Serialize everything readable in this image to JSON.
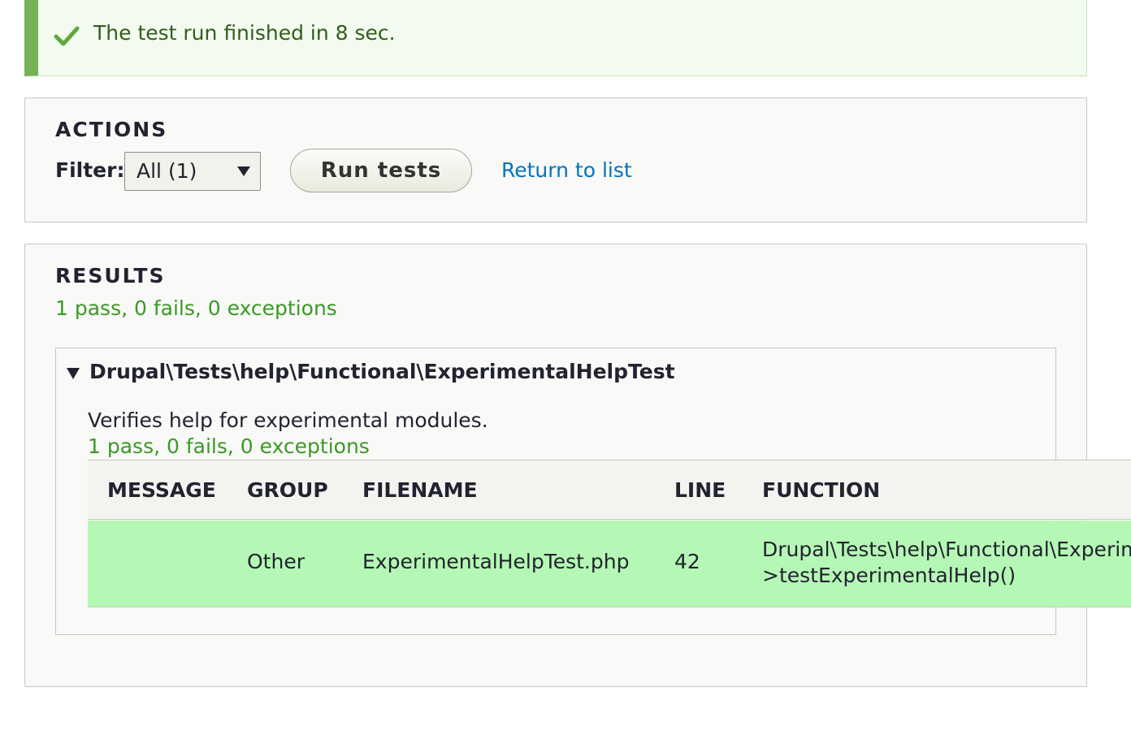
{
  "status": {
    "icon": "checkmark-icon",
    "message": "The test run finished in 8 sec.",
    "color": "#77b259"
  },
  "actions": {
    "legend": "Actions",
    "filter_label": "Filter:",
    "filter_value": "All (1)",
    "run_button": "Run tests",
    "return_link": "Return to list"
  },
  "results": {
    "legend": "Results",
    "summary": "1 pass, 0 fails, 0 exceptions",
    "test": {
      "name": "Drupal\\Tests\\help\\Functional\\ExperimentalHelpTest",
      "description": "Verifies help for experimental modules.",
      "summary": "1 pass, 0 fails, 0 exceptions",
      "columns": [
        "Message",
        "Group",
        "Filename",
        "Line",
        "Function"
      ],
      "rows": [
        {
          "message": "",
          "group": "Other",
          "filename": "ExperimentalHelpTest.php",
          "line": "42",
          "function_line1": "Drupal\\Tests\\help\\Functional\\ExperimentalHelpTest-",
          "function_line2": ">testExperimentalHelp()",
          "status_color": "#b5f8b5"
        }
      ]
    }
  }
}
